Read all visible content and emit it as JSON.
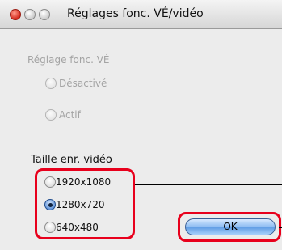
{
  "window": {
    "title": "Réglages fonc. VÉ/vidéo"
  },
  "section_ve": {
    "heading": "Réglage fonc. VÉ",
    "options": [
      {
        "label": "Désactivé",
        "selected": false
      },
      {
        "label": "Actif",
        "selected": false
      }
    ]
  },
  "section_video": {
    "heading": "Taille enr. vidéo",
    "options": [
      {
        "label": "1920x1080",
        "selected": false
      },
      {
        "label": "1280x720",
        "selected": true
      },
      {
        "label": "640x480",
        "selected": false
      }
    ]
  },
  "buttons": {
    "ok_label": "OK"
  },
  "colors": {
    "highlight": "#e8001c",
    "accent": "#5b8fd6"
  }
}
